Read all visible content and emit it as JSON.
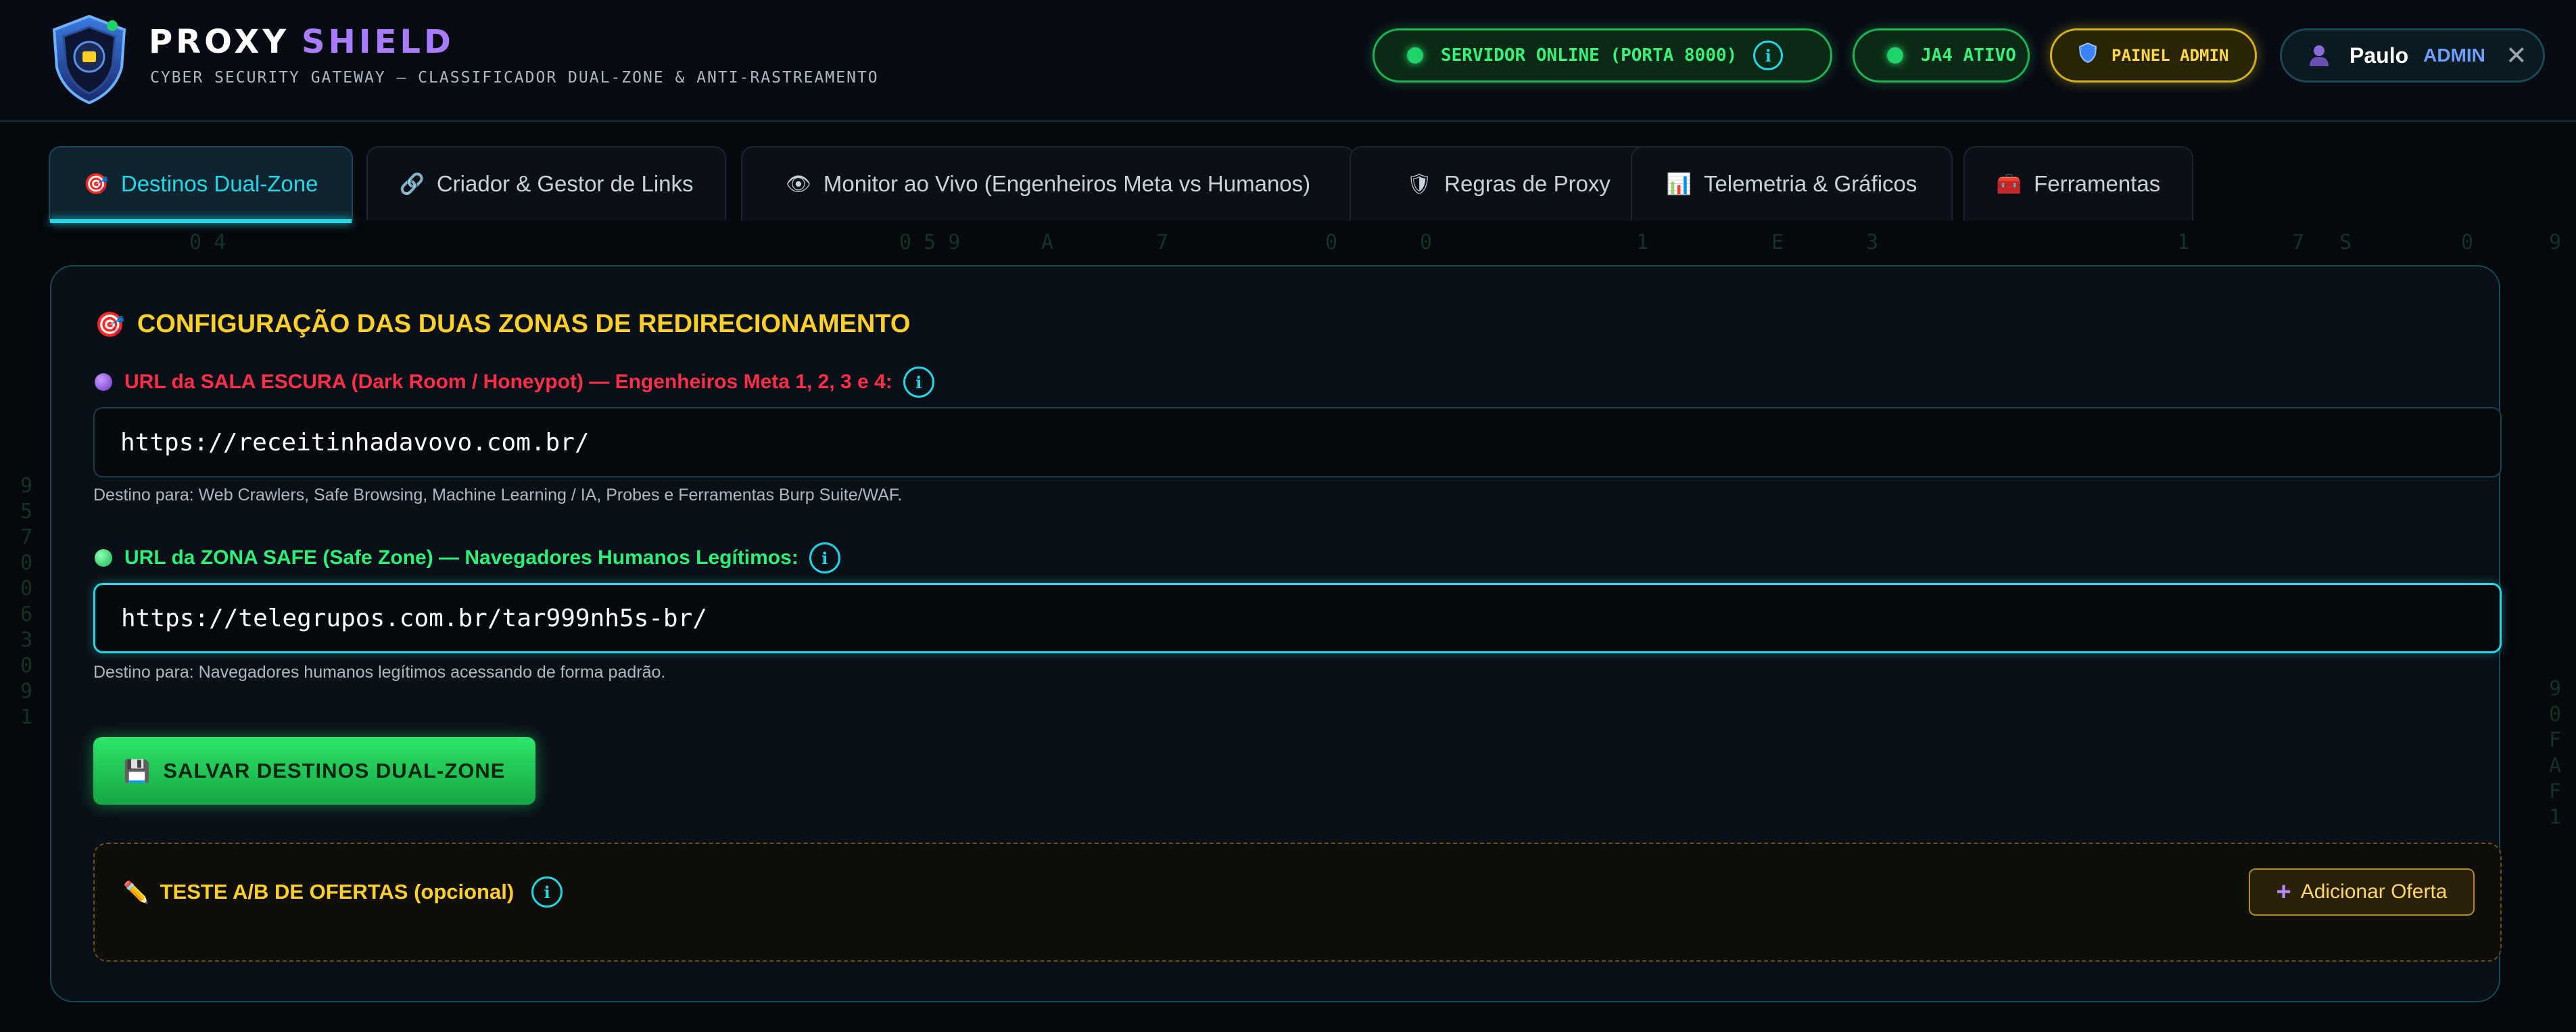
{
  "header": {
    "brand_part1": "PROXY",
    "brand_part2": "SHIELD",
    "tagline": "CYBER SECURITY GATEWAY — CLASSIFICADOR DUAL-ZONE & ANTI-RASTREAMENTO",
    "status_server": "SERVIDOR ONLINE (PORTA 8000)",
    "status_ja4": "JA4 ATIVO",
    "admin_panel": "PAINEL ADMIN",
    "user_name": "Paulo",
    "user_role": "ADMIN"
  },
  "tabs": [
    {
      "label": "Destinos Dual-Zone",
      "icon": "target-icon",
      "active": true
    },
    {
      "label": "Criador & Gestor de Links",
      "icon": "link-icon"
    },
    {
      "label": "Monitor ao Vivo (Engenheiros Meta vs Humanos)",
      "icon": "eye-icon"
    },
    {
      "label": "Regras de Proxy",
      "icon": "shield-icon"
    },
    {
      "label": "Telemetria & Gráficos",
      "icon": "bar-chart-icon"
    },
    {
      "label": "Ferramentas",
      "icon": "toolbox-icon"
    }
  ],
  "main": {
    "section_title": "CONFIGURAÇÃO DAS DUAS ZONAS DE REDIRECIONAMENTO",
    "dark_label": "URL da SALA ESCURA (Dark Room / Honeypot) — Engenheiros Meta 1, 2, 3 e 4:",
    "dark_url": "https://receitinhadavovo.com.br/",
    "dark_help": "Destino para: Web Crawlers, Safe Browsing, Machine Learning / IA, Probes e Ferramentas Burp Suite/WAF.",
    "safe_label": "URL da ZONA SAFE (Safe Zone) — Navegadores Humanos Legítimos:",
    "safe_url": "https://telegrupos.com.br/tar999nh5s-br/",
    "safe_help": "Destino para: Navegadores humanos legítimos acessando de forma padrão.",
    "save_label": "SALVAR DESTINOS DUAL-ZONE",
    "ab_title": "TESTE A/B DE OFERTAS (opcional)",
    "add_offer_label": "Adicionar Oferta"
  },
  "colors": {
    "accent_cyan": "#22d8e6",
    "status_green": "#2cf07a",
    "warning_yellow": "#ffd02a",
    "danger_red": "#ff2f4a"
  }
}
